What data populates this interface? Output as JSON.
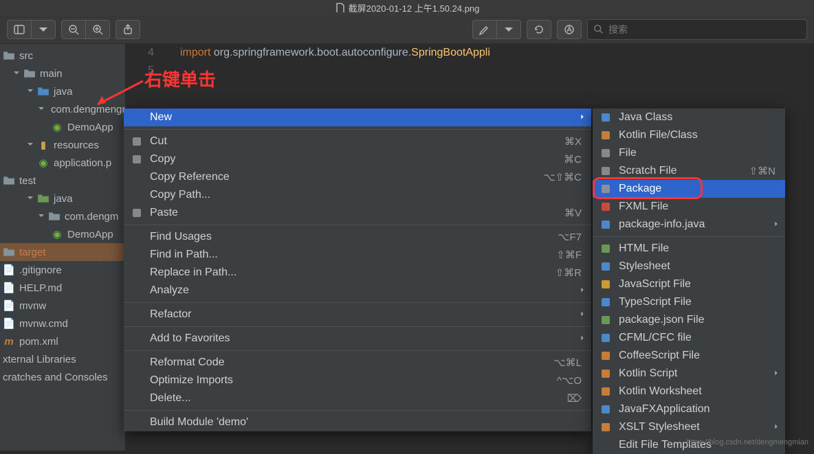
{
  "title": "截屏2020-01-12 上午1.50.24.png",
  "toolbar": {
    "search_placeholder": "搜索"
  },
  "annotation": "右键单击",
  "tree": {
    "src": "src",
    "main": "main",
    "java": "java",
    "pkg": "com.dengmengmian.www.demo",
    "demoApp": "DemoApp",
    "resources": "resources",
    "applicationp": "application.p",
    "test": "test",
    "java2": "java",
    "pkg2": "com.dengm",
    "demoApp2": "DemoApp",
    "target": "target",
    "gitignore": ".gitignore",
    "help": "HELP.md",
    "mvnw": "mvnw",
    "mvnwcmd": "mvnw.cmd",
    "pom": "pom.xml",
    "extlib": "xternal Libraries",
    "scratches": "cratches and Consoles"
  },
  "editor": {
    "line_numbers": [
      "4",
      "5"
    ],
    "import_kw": "import",
    "import_pkg": " org.springframework.boot.autoconfigure.",
    "import_class": "SpringBootAppli"
  },
  "ctx1": [
    {
      "label": "New",
      "type": "item",
      "selected": true,
      "submenu": true
    },
    {
      "type": "sep"
    },
    {
      "label": "Cut",
      "shortcut": "⌘X",
      "icon": "scissors"
    },
    {
      "label": "Copy",
      "shortcut": "⌘C",
      "icon": "copy"
    },
    {
      "label": "Copy Reference",
      "shortcut": "⌥⇧⌘C"
    },
    {
      "label": "Copy Path..."
    },
    {
      "label": "Paste",
      "shortcut": "⌘V",
      "icon": "clipboard"
    },
    {
      "type": "sep"
    },
    {
      "label": "Find Usages",
      "shortcut": "⌥F7"
    },
    {
      "label": "Find in Path...",
      "shortcut": "⇧⌘F"
    },
    {
      "label": "Replace in Path...",
      "shortcut": "⇧⌘R"
    },
    {
      "label": "Analyze",
      "submenu": true
    },
    {
      "type": "sep"
    },
    {
      "label": "Refactor",
      "submenu": true
    },
    {
      "type": "sep"
    },
    {
      "label": "Add to Favorites",
      "submenu": true
    },
    {
      "type": "sep"
    },
    {
      "label": "Reformat Code",
      "shortcut": "⌥⌘L"
    },
    {
      "label": "Optimize Imports",
      "shortcut": "^⌥O"
    },
    {
      "label": "Delete...",
      "shortcut": "⌦"
    },
    {
      "type": "sep"
    },
    {
      "label": "Build Module 'demo'"
    }
  ],
  "ctx2": [
    {
      "label": "Java Class",
      "icon": "java",
      "color": "#4a88c7"
    },
    {
      "label": "Kotlin File/Class",
      "icon": "kotlin",
      "color": "#c77d3a"
    },
    {
      "label": "File",
      "icon": "file",
      "color": "#888"
    },
    {
      "label": "Scratch File",
      "shortcut": "⇧⌘N",
      "icon": "scratch",
      "color": "#888"
    },
    {
      "label": "Package",
      "selected": true,
      "icon": "package",
      "color": "#87939a"
    },
    {
      "label": "FXML File",
      "icon": "fxml",
      "color": "#c94a3a"
    },
    {
      "label": "package-info.java",
      "icon": "java",
      "color": "#4a88c7",
      "submenu": true
    },
    {
      "type": "sep"
    },
    {
      "label": "HTML File",
      "icon": "html",
      "color": "#6a9955"
    },
    {
      "label": "Stylesheet",
      "icon": "css",
      "color": "#4a88c7"
    },
    {
      "label": "JavaScript File",
      "icon": "js",
      "color": "#cc9933"
    },
    {
      "label": "TypeScript File",
      "icon": "ts",
      "color": "#4a88c7"
    },
    {
      "label": "package.json File",
      "icon": "json",
      "color": "#6a9955"
    },
    {
      "label": "CFML/CFC file",
      "icon": "cfml",
      "color": "#4a88c7"
    },
    {
      "label": "CoffeeScript File",
      "icon": "coffee",
      "color": "#c77d3a"
    },
    {
      "label": "Kotlin Script",
      "icon": "kotlin",
      "color": "#c77d3a",
      "submenu": true
    },
    {
      "label": "Kotlin Worksheet",
      "icon": "kotlin",
      "color": "#c77d3a"
    },
    {
      "label": "JavaFXApplication",
      "icon": "java",
      "color": "#4a88c7"
    },
    {
      "label": "XSLT Stylesheet",
      "icon": "xslt",
      "color": "#c77d3a",
      "submenu": true
    },
    {
      "label": "Edit File Templates"
    }
  ],
  "watermark": "https://blog.csdn.net/dengmengmian"
}
